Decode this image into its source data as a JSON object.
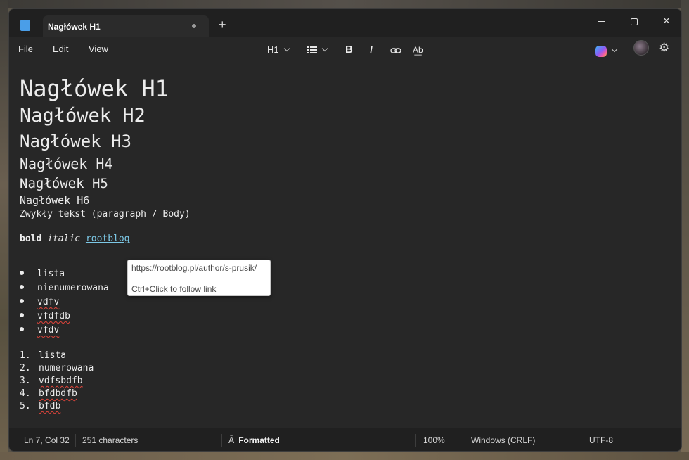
{
  "window": {
    "tab_title": "Nagłówek H1",
    "new_tab_symbol": "+",
    "controls": {
      "minimize": "",
      "maximize": "",
      "close": "✕"
    }
  },
  "menu": {
    "file": "File",
    "edit": "Edit",
    "view": "View"
  },
  "toolbar": {
    "heading_select": "H1",
    "bold": "B",
    "italic": "I",
    "spellcheck": "A͟b",
    "settings_icon": "⚙"
  },
  "document": {
    "h1": "Nagłówek H1",
    "h2": "Nagłówek H2",
    "h3": "Nagłówek H3",
    "h4": "Nagłówek H4",
    "h5": "Nagłówek H5",
    "h6": "Nagłówek H6",
    "paragraph": "Zwykły tekst (paragraph / Body)",
    "format_line": {
      "bold": "bold",
      "italic": "italic",
      "link": "rootblog"
    },
    "bullets": [
      "lista",
      "nienumerowana",
      "vdfv",
      "vfdfdb",
      "vfdv"
    ],
    "numbered": [
      {
        "n": "1.",
        "text": "lista"
      },
      {
        "n": "2.",
        "text": "numerowana"
      },
      {
        "n": "3.",
        "text": "vdfsbdfb"
      },
      {
        "n": "4.",
        "text": "bfdbdfb"
      },
      {
        "n": "5.",
        "text": "bfdb"
      }
    ]
  },
  "tooltip": {
    "url": "https://rootblog.pl/author/s-prusik/",
    "hint": "Ctrl+Click to follow link"
  },
  "status": {
    "position": "Ln 7, Col 32",
    "characters": "251 characters",
    "format": "Formatted",
    "zoom": "100%",
    "line_ending": "Windows (CRLF)",
    "encoding": "UTF-8"
  },
  "icons": {
    "app": "notepad-icon",
    "list": "bulleted-list-icon",
    "link": "link-icon",
    "copilot": "copilot-icon",
    "avatar": "user-avatar",
    "settings": "gear-icon",
    "format": "formatted-icon"
  }
}
